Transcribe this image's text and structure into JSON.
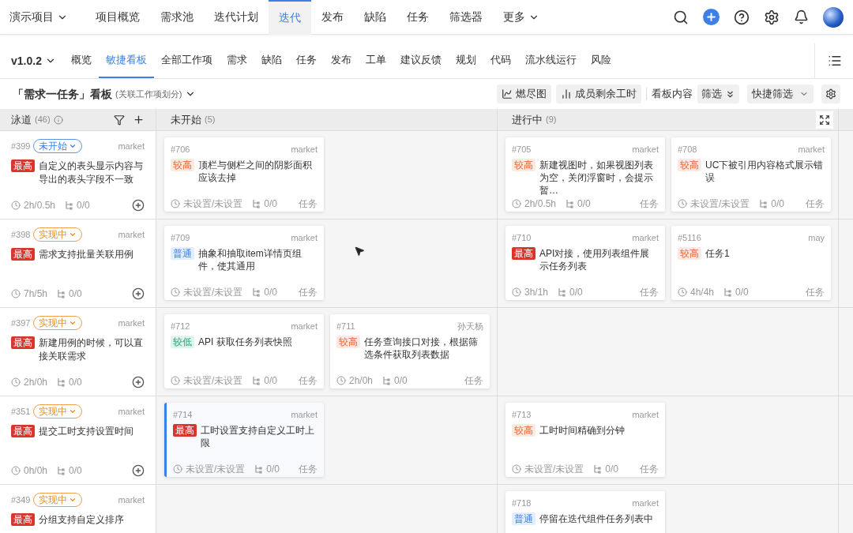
{
  "top_nav": {
    "project": "演示项目",
    "items": [
      {
        "label": "项目概览",
        "selected": false
      },
      {
        "label": "需求池",
        "selected": false
      },
      {
        "label": "迭代计划",
        "selected": false
      },
      {
        "label": "迭代",
        "selected": true
      },
      {
        "label": "发布",
        "selected": false
      },
      {
        "label": "缺陷",
        "selected": false
      },
      {
        "label": "任务",
        "selected": false
      },
      {
        "label": "筛选器",
        "selected": false
      }
    ],
    "more": "更多"
  },
  "sub_nav": {
    "version": "v1.0.2",
    "tabs": [
      {
        "label": "概览",
        "selected": false
      },
      {
        "label": "敏捷看板",
        "selected": true
      },
      {
        "label": "全部工作项",
        "selected": false
      },
      {
        "label": "需求",
        "selected": false
      },
      {
        "label": "缺陷",
        "selected": false
      },
      {
        "label": "任务",
        "selected": false
      },
      {
        "label": "发布",
        "selected": false
      },
      {
        "label": "工单",
        "selected": false
      },
      {
        "label": "建议反馈",
        "selected": false
      },
      {
        "label": "规划",
        "selected": false
      },
      {
        "label": "代码",
        "selected": false
      },
      {
        "label": "流水线运行",
        "selected": false
      },
      {
        "label": "风险",
        "selected": false
      }
    ]
  },
  "toolbar": {
    "title": "「需求一任务」看板",
    "subtitle": "(关联工作项划分)",
    "burndown": "燃尽图",
    "remaining": "成员剩余工时",
    "content_label": "看板内容",
    "filter": "筛选",
    "quick_filter": "快捷筛选"
  },
  "board": {
    "lane_header": {
      "label": "泳道",
      "count": "(46)"
    },
    "columns": [
      {
        "label": "未开始",
        "count": "(5)"
      },
      {
        "label": "进行中",
        "count": "(9)"
      }
    ],
    "lanes": [
      {
        "id": "#399",
        "status": {
          "kind": "todo",
          "label": "未开始"
        },
        "owner": "market",
        "priority": {
          "kind": "highest",
          "label": "最高"
        },
        "title": "自定义的表头显示内容与导出的表头字段不一致",
        "time": "2h/0.5h",
        "subtasks": "0/0",
        "cells": [
          [
            {
              "id": "#706",
              "owner": "market",
              "priority": {
                "kind": "high",
                "label": "较高"
              },
              "title": "顶栏与侧栏之间的阴影面积应该去掉",
              "time": "未设置/未设置",
              "subtasks": "0/0",
              "type": "任务",
              "selected": false
            }
          ],
          [
            {
              "id": "#705",
              "owner": "market",
              "priority": {
                "kind": "high",
                "label": "较高"
              },
              "title": "新建视图时，如果视图列表为空，关闭浮窗时，会提示暂…",
              "time": "2h/0.5h",
              "subtasks": "0/0",
              "type": "任务",
              "selected": false
            },
            {
              "id": "#708",
              "owner": "market",
              "priority": {
                "kind": "high",
                "label": "较高"
              },
              "title": "UC下被引用内容格式展示错误",
              "time": "未设置/未设置",
              "subtasks": "0/0",
              "type": "任务",
              "selected": false
            }
          ]
        ]
      },
      {
        "id": "#398",
        "status": {
          "kind": "doing",
          "label": "实现中"
        },
        "owner": "market",
        "priority": {
          "kind": "highest",
          "label": "最高"
        },
        "title": "需求支持批量关联用例",
        "time": "7h/5h",
        "subtasks": "0/0",
        "cells": [
          [
            {
              "id": "#709",
              "owner": "market",
              "priority": {
                "kind": "normal",
                "label": "普通"
              },
              "title": "抽象和抽取item详情页组件，使其通用",
              "time": "未设置/未设置",
              "subtasks": "0/0",
              "type": "任务",
              "selected": false
            }
          ],
          [
            {
              "id": "#710",
              "owner": "market",
              "priority": {
                "kind": "highest",
                "label": "最高"
              },
              "title": "API对接，使用列表组件展示任务列表",
              "time": "3h/1h",
              "subtasks": "0/0",
              "type": "任务",
              "selected": false
            },
            {
              "id": "#5116",
              "owner": "may",
              "priority": {
                "kind": "high",
                "label": "较高"
              },
              "title": "任务1",
              "time": "4h/4h",
              "subtasks": "0/0",
              "type": "任务",
              "selected": false
            }
          ]
        ]
      },
      {
        "id": "#397",
        "status": {
          "kind": "doing",
          "label": "实现中"
        },
        "owner": "market",
        "priority": {
          "kind": "highest",
          "label": "最高"
        },
        "title": "新建用例的时候，可以直接关联需求",
        "time": "2h/0h",
        "subtasks": "0/0",
        "cells": [
          [
            {
              "id": "#712",
              "owner": "market",
              "priority": {
                "kind": "low",
                "label": "较低"
              },
              "title": "API 获取任务列表快照",
              "time": "未设置/未设置",
              "subtasks": "0/0",
              "type": "任务",
              "selected": false
            },
            {
              "id": "#711",
              "owner": "孙天杨",
              "priority": {
                "kind": "high",
                "label": "较高"
              },
              "title": "任务查询接口对接，根据筛选条件获取列表数据",
              "time": "2h/0h",
              "subtasks": "0/0",
              "type": "任务",
              "selected": false
            }
          ],
          []
        ]
      },
      {
        "id": "#351",
        "status": {
          "kind": "doing",
          "label": "实现中"
        },
        "owner": "market",
        "priority": {
          "kind": "highest",
          "label": "最高"
        },
        "title": "提交工时支持设置时间",
        "time": "0h/0h",
        "subtasks": "0/0",
        "cells": [
          [
            {
              "id": "#714",
              "owner": "market",
              "priority": {
                "kind": "highest",
                "label": "最高"
              },
              "title": "工时设置支持自定义工时上限",
              "time": "未设置/未设置",
              "subtasks": "0/0",
              "type": "任务",
              "selected": true
            }
          ],
          [
            {
              "id": "#713",
              "owner": "market",
              "priority": {
                "kind": "high",
                "label": "较高"
              },
              "title": "工时时间精确到分钟",
              "time": "未设置/未设置",
              "subtasks": "0/0",
              "type": "任务",
              "selected": false
            }
          ]
        ]
      },
      {
        "id": "#349",
        "status": {
          "kind": "doing",
          "label": "实现中"
        },
        "owner": "market",
        "priority": {
          "kind": "highest",
          "label": "最高"
        },
        "title": "分组支持自定义排序",
        "cells": [
          [],
          [
            {
              "id": "#718",
              "owner": "market",
              "priority": {
                "kind": "normal",
                "label": "普通"
              },
              "title": "停留在迭代组件任务列表中",
              "selected": false
            }
          ]
        ]
      }
    ]
  }
}
